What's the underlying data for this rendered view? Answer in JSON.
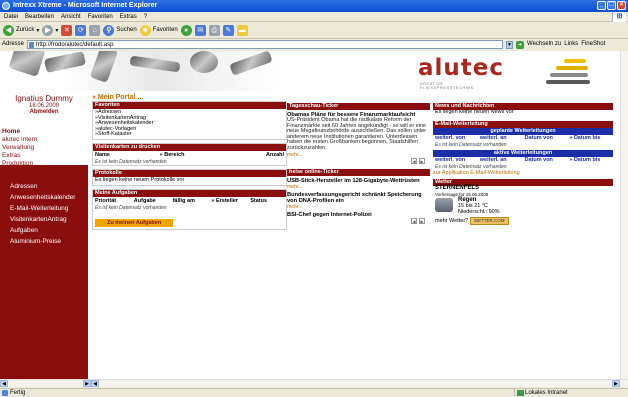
{
  "window": {
    "title": "Intrexx Xtreme - Microsoft Internet Explorer"
  },
  "menu": [
    "Datei",
    "Bearbeiten",
    "Ansicht",
    "Favoriten",
    "Extras",
    "?"
  ],
  "toolbar": {
    "back": "Zurück",
    "search": "Suchen",
    "favorites": "Favoriten"
  },
  "address": {
    "label": "Adresse",
    "url": "http://frodo/alutec/default.asp",
    "go": "Wechseln zu",
    "links": "Links",
    "fineshot": "FineShot"
  },
  "status": {
    "text": "Fertig",
    "zone": "Lokales Intranet"
  },
  "logo": {
    "word": "alutec",
    "line1": "KREATIVE",
    "line2": "FLIESSPRESSTECHNIK"
  },
  "user": {
    "name": "Ignatius Dummy",
    "date": "18.06.2009",
    "logout": "Abmelden"
  },
  "nav_top": [
    {
      "label": "Home"
    },
    {
      "label": "alutec intern"
    },
    {
      "label": "Verwaltung"
    },
    {
      "label": "Extras"
    },
    {
      "label": "Produktion"
    }
  ],
  "nav_bottom": [
    "Adressen",
    "Anwesenheitskalender",
    "E-Mail-Weiterleitung",
    "VisitenkartenAntrag",
    "Aufgaben",
    "Aluminium-Preise"
  ],
  "portal": {
    "title": "» Mein Portal ...",
    "favorites": {
      "header": "Favoriten",
      "items": [
        "»Adressen",
        "»VisitenkartenAntrag",
        "»Anwesenheitskalender",
        "»alutec-Vorlagen",
        "»Stoff-Kataster"
      ]
    },
    "cards": {
      "header": "Visitenkarten zu drucken",
      "cols": [
        "Name",
        "» Bereich",
        "Anzahl"
      ],
      "empty": "Es ist kein Datensatz vorhanden"
    },
    "protocols": {
      "header": "Protokolle",
      "text": "Es liegen keine neuen Protokolle vor"
    },
    "tasks": {
      "header": "Meine Aufgaben",
      "cols": [
        "Priorität",
        "Aufgabe",
        "fällig am",
        "» Ersteller",
        "Status"
      ],
      "empty": "Es ist kein Datensatz vorhanden",
      "button": "Zu meinen Aufgaben"
    }
  },
  "tagesschau": {
    "header": "Tagesschau-Ticker",
    "title": "Obamas Pläne für bessere Finanzmarktaufsicht",
    "text": "US-Präsident Obama hat die radikalste Reform der Finanzmärkte seit 60 Jahren angekündigt - so will er eine neue Megafinanzbehörde ausschließen. Das sollen unter anderem neue Institutionen garantieren. Unterdessen haben die ersten Großbanken begonnen, Staatshilfen zurückzuzahlen.",
    "mehr": "mehr..."
  },
  "heise": {
    "header": "heise online-Ticker",
    "items": [
      {
        "title": "USB-Stick-Hersteller im 128-Gigabyte-Wettrüsten",
        "mehr": "mehr..."
      },
      {
        "title": "Bundesverfassungsgericht schränkt Speicherung von DNA-Profilen ein",
        "mehr": "mehr..."
      },
      {
        "title": "BSI-Chef gegen Internet-Polizei",
        "mehr": ""
      }
    ]
  },
  "news": {
    "header": "News und Nachrichten",
    "text": "Es liegen keine neuen News vor"
  },
  "email": {
    "header": "E-Mail-Weiterleitung",
    "planned": "geplante Weiterleitungen",
    "active": "aktive Weiterleitungen",
    "cols": [
      "weiterl. von",
      "weiterl. an",
      "Datum von",
      "» Datum bis"
    ],
    "empty": "Es ist kein Datensatz vorhanden",
    "link": "zur Applikation E-Mail-Weiterleitung"
  },
  "weather": {
    "header": "Wetter",
    "city": "STERNENFELS",
    "date": "Vorhersage für 15.06.2009",
    "cond": "Regen",
    "temp": "15 bis 21 °C",
    "rain": "Niederschl.: 90%",
    "more": "mehr Wetter?",
    "btn": "WETTER.COM"
  }
}
